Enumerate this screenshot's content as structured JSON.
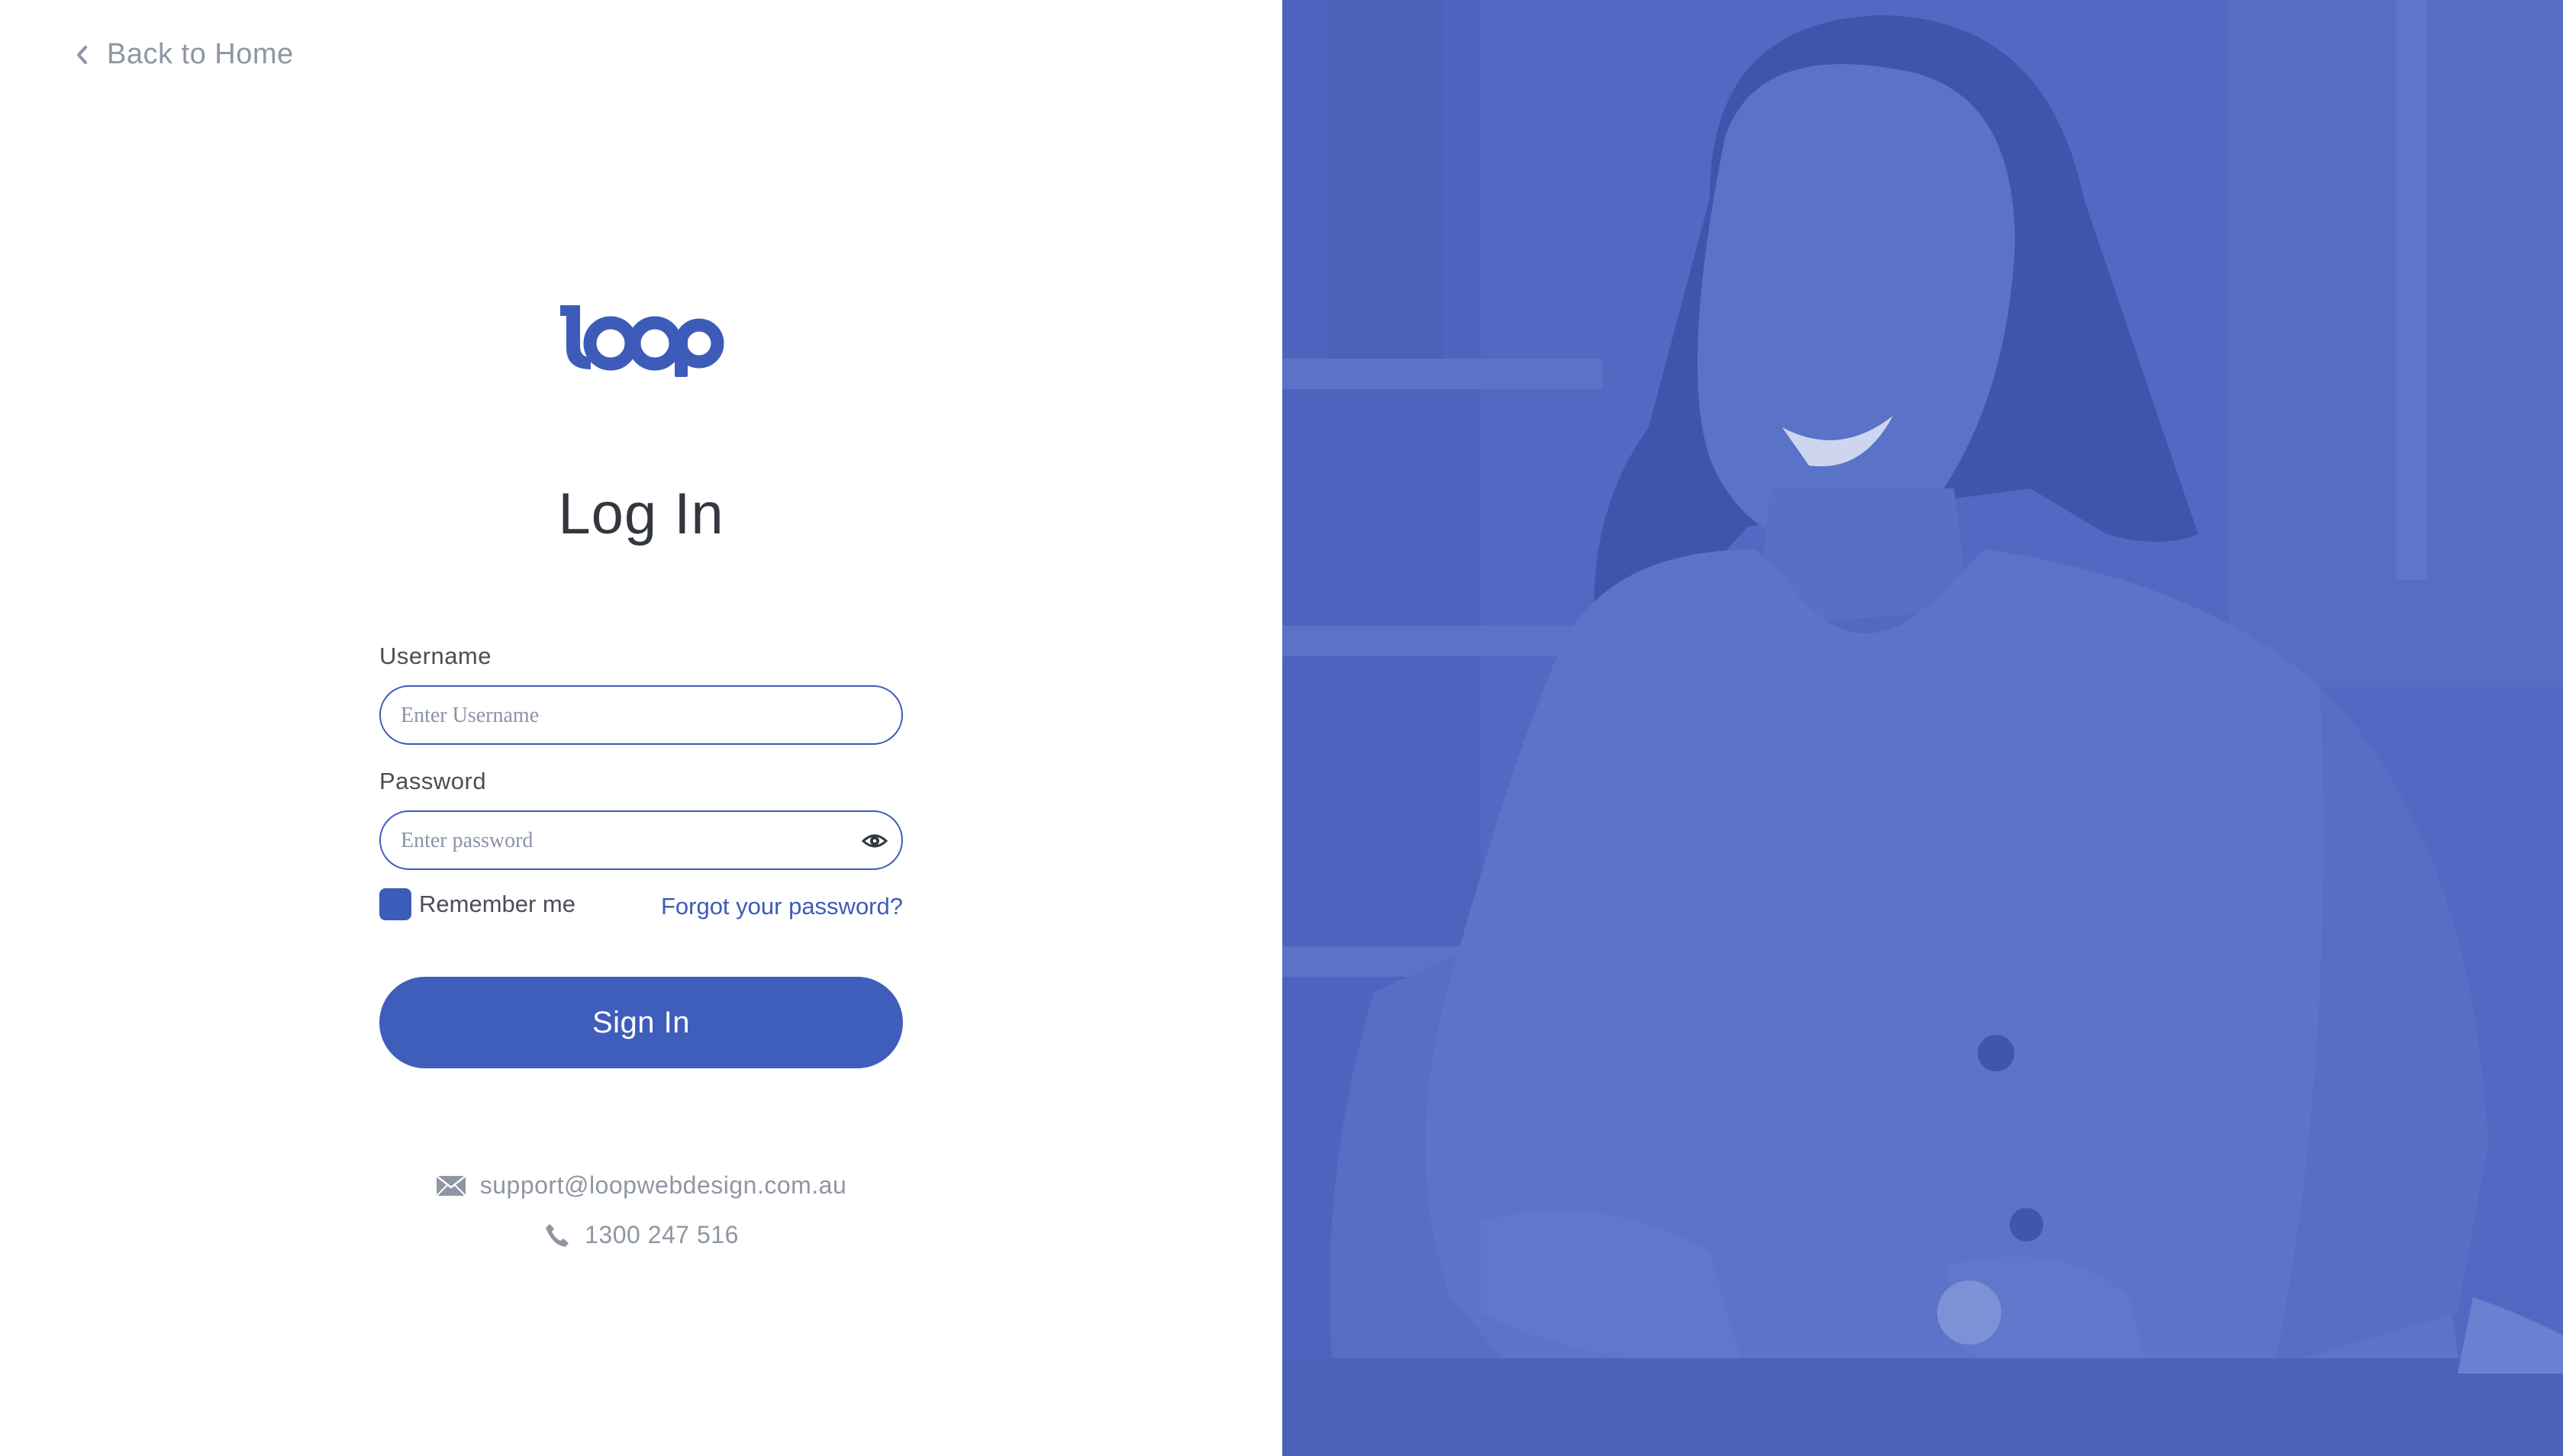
{
  "nav": {
    "back_label": "Back to Home"
  },
  "brand": {
    "logo_text": "loop",
    "color": "#3d5bb8"
  },
  "page": {
    "title": "Log In"
  },
  "form": {
    "username": {
      "label": "Username",
      "placeholder": "Enter Username",
      "value": ""
    },
    "password": {
      "label": "Password",
      "placeholder": "Enter password",
      "value": ""
    },
    "remember_label": "Remember me",
    "remember_checked": true,
    "forgot_label": "Forgot your password?",
    "submit_label": "Sign In"
  },
  "contact": {
    "email": "support@loopwebdesign.com.au",
    "phone": "1300 247 516"
  },
  "icons": [
    "chevron-left-icon",
    "eye-icon",
    "envelope-icon",
    "phone-icon"
  ],
  "colors": {
    "accent": "#3f5dbb",
    "hero_overlay": "#5169c2",
    "muted_text": "#8f96a3"
  }
}
